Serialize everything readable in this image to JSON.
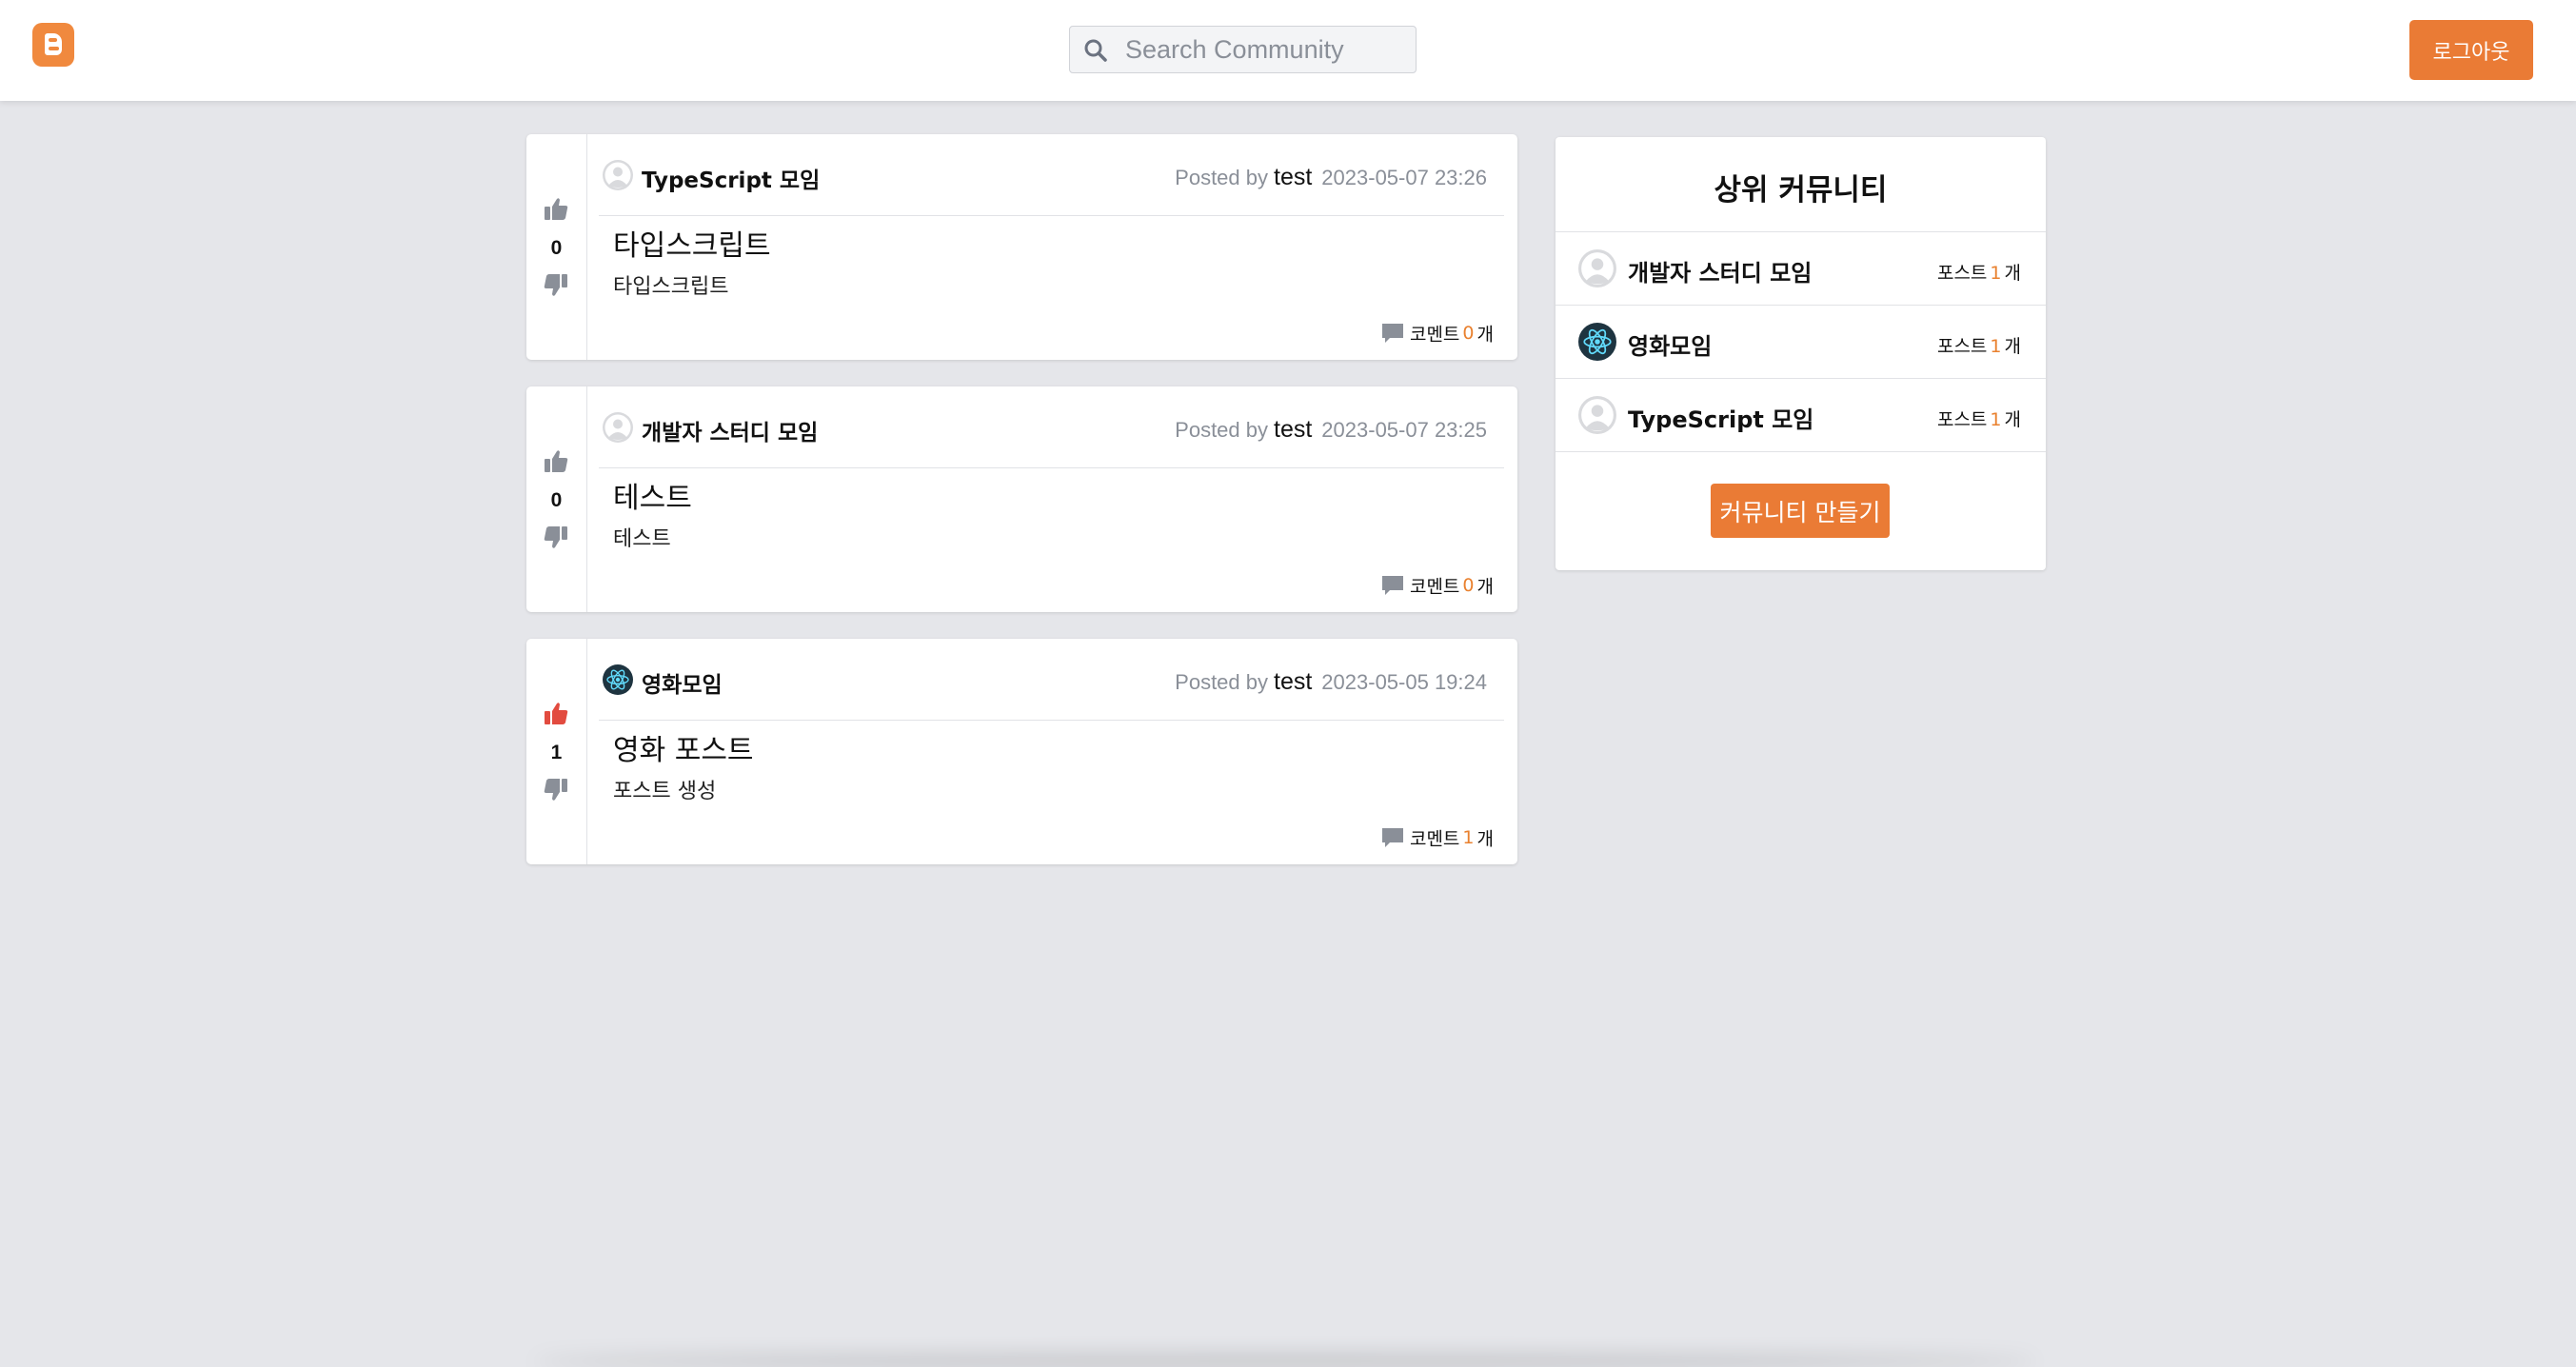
{
  "header": {
    "logo_icon": "blogger-logo-icon",
    "search": {
      "placeholder": "Search Community",
      "value": "",
      "icon": "search-icon"
    },
    "logout_label": "로그아웃"
  },
  "posts": [
    {
      "community": "TypeScript 모임",
      "community_icon": "default-avatar-icon",
      "posted_by_label": "Posted by",
      "author": "test",
      "date": "2023-05-07 23:26",
      "title": "타입스크립트",
      "body": "타입스크립트",
      "votes": "0",
      "voted_up": false,
      "comment_label": "코멘트",
      "comment_count": "0",
      "comment_unit": "개"
    },
    {
      "community": "개발자 스터디 모임",
      "community_icon": "default-avatar-icon",
      "posted_by_label": "Posted by",
      "author": "test",
      "date": "2023-05-07 23:25",
      "title": "테스트",
      "body": "테스트",
      "votes": "0",
      "voted_up": false,
      "comment_label": "코멘트",
      "comment_count": "0",
      "comment_unit": "개"
    },
    {
      "community": "영화모임",
      "community_icon": "react-atom-icon",
      "posted_by_label": "Posted by",
      "author": "test",
      "date": "2023-05-05 19:24",
      "title": "영화 포스트",
      "body": "포스트 생성",
      "votes": "1",
      "voted_up": true,
      "comment_label": "코멘트",
      "comment_count": "1",
      "comment_unit": "개"
    }
  ],
  "sidebar": {
    "title": "상위 커뮤니티",
    "communities": [
      {
        "name": "개발자 스터디 모임",
        "icon": "default-avatar-icon",
        "posts_label": "포스트",
        "post_count": "1",
        "unit": "개"
      },
      {
        "name": "영화모임",
        "icon": "react-atom-icon",
        "posts_label": "포스트",
        "post_count": "1",
        "unit": "개"
      },
      {
        "name": "TypeScript 모임",
        "icon": "default-avatar-icon",
        "posts_label": "포스트",
        "post_count": "1",
        "unit": "개"
      }
    ],
    "create_label": "커뮤니티 만들기"
  },
  "colors": {
    "accent": "#ea7b35",
    "count_highlight": "#e9812f",
    "vote_active": "#e24b3f",
    "vote_inactive": "#8a8f98",
    "background": "#e5e6ea"
  }
}
